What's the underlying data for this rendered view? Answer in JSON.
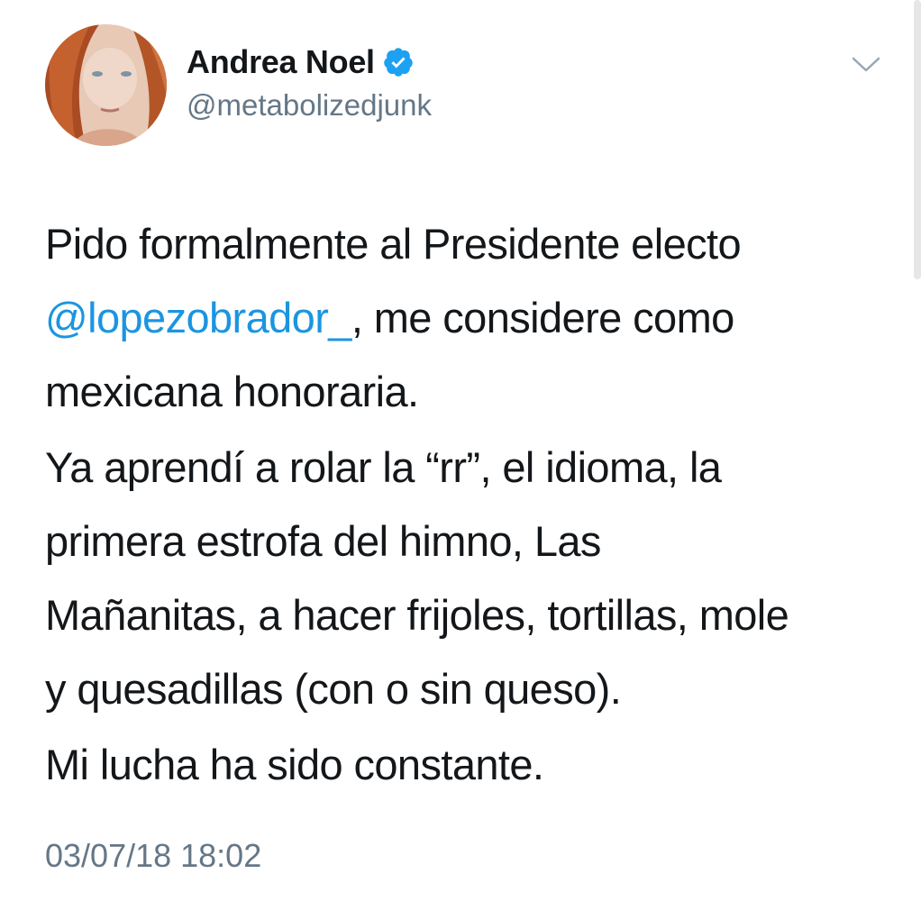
{
  "tweet": {
    "display_name": "Andrea Noel",
    "handle": "@metabolizedjunk",
    "verified": true,
    "paragraphs": [
      {
        "mention": "@lopezobrador_",
        "line1": "Pido formalmente al Presidente electo",
        "after_mention": ", me considere como",
        "line3": "mexicana honoraria."
      },
      {
        "lines": [
          "Ya aprendí a rolar la “rr”, el idioma, la",
          "primera estrofa del himno, Las",
          "Mañanitas, a hacer frijoles, tortillas, mole",
          "y quesadillas (con o sin queso)."
        ]
      },
      {
        "lines": [
          "Mi lucha ha sido constante."
        ]
      }
    ],
    "timestamp": "03/07/18 18:02"
  },
  "icons": {
    "verified": "verified-badge-icon",
    "caret": "chevron-down-icon"
  },
  "colors": {
    "text": "#14171a",
    "secondary": "#657786",
    "link": "#1b95e0",
    "verified": "#1da1f2"
  }
}
